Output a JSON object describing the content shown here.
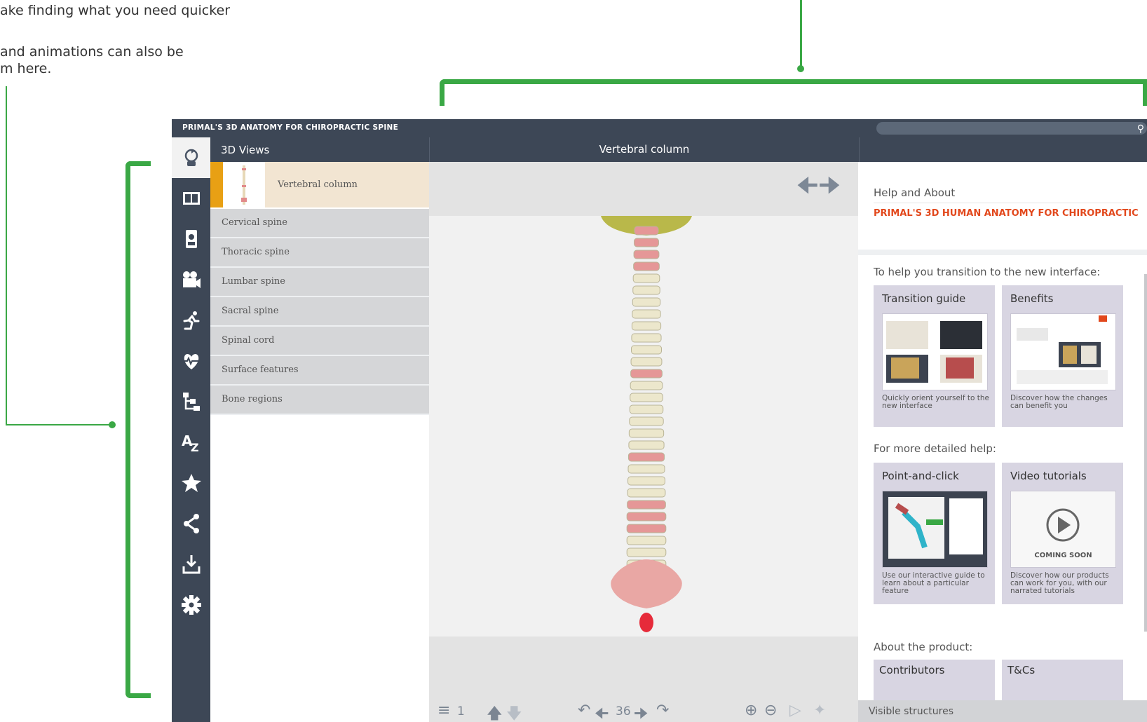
{
  "annotations": {
    "top_line1": "ake finding what you need quicker",
    "top_line2": "and animations can also be",
    "top_line3": "m here."
  },
  "app": {
    "title": "PRIMAL'S 3D ANATOMY FOR CHIROPRACTIC SPINE",
    "header": {
      "left_title": "3D Views",
      "center_title": "Vertebral column"
    },
    "sidebar_icons": [
      "rotate-3d-icon",
      "compare-icon",
      "layers-body-icon",
      "video-camera-icon",
      "movement-icon",
      "heart-pulse-icon",
      "hierarchy-icon",
      "a-z-icon",
      "star-icon",
      "share-icon",
      "download-icon",
      "settings-icon"
    ],
    "views": {
      "selected": "Vertebral column",
      "items": [
        "Cervical spine",
        "Thoracic spine",
        "Lumbar spine",
        "Sacral spine",
        "Spinal cord",
        "Surface features",
        "Bone regions"
      ]
    },
    "toolbar": {
      "layer_number": "1",
      "rotation_step": "36"
    },
    "help": {
      "title": "Help and About",
      "product": "PRIMAL'S 3D HUMAN ANATOMY FOR CHIROPRACTIC",
      "transition_heading": "To help you transition to the new interface:",
      "detailed_heading": "For more detailed help:",
      "about_heading": "About the product:",
      "cards": [
        {
          "title": "Transition guide",
          "desc": "Quickly orient yourself to the new interface"
        },
        {
          "title": "Benefits",
          "desc": "Discover how the changes can benefit you"
        },
        {
          "title": "Point-and-click",
          "desc": "Use our interactive guide to learn about a particular feature"
        },
        {
          "title": "Video tutorials",
          "desc": "Discover how our products can work for you, with our narrated tutorials",
          "badge": "COMING SOON"
        }
      ],
      "about_cards": [
        "Contributors",
        "T&Cs"
      ],
      "visible_structures": "Visible structures"
    },
    "colors": {
      "accent_green": "#3aa845",
      "dark_bar": "#3d4756",
      "product_red": "#e2481c",
      "selected_orange": "#e8a014"
    }
  }
}
